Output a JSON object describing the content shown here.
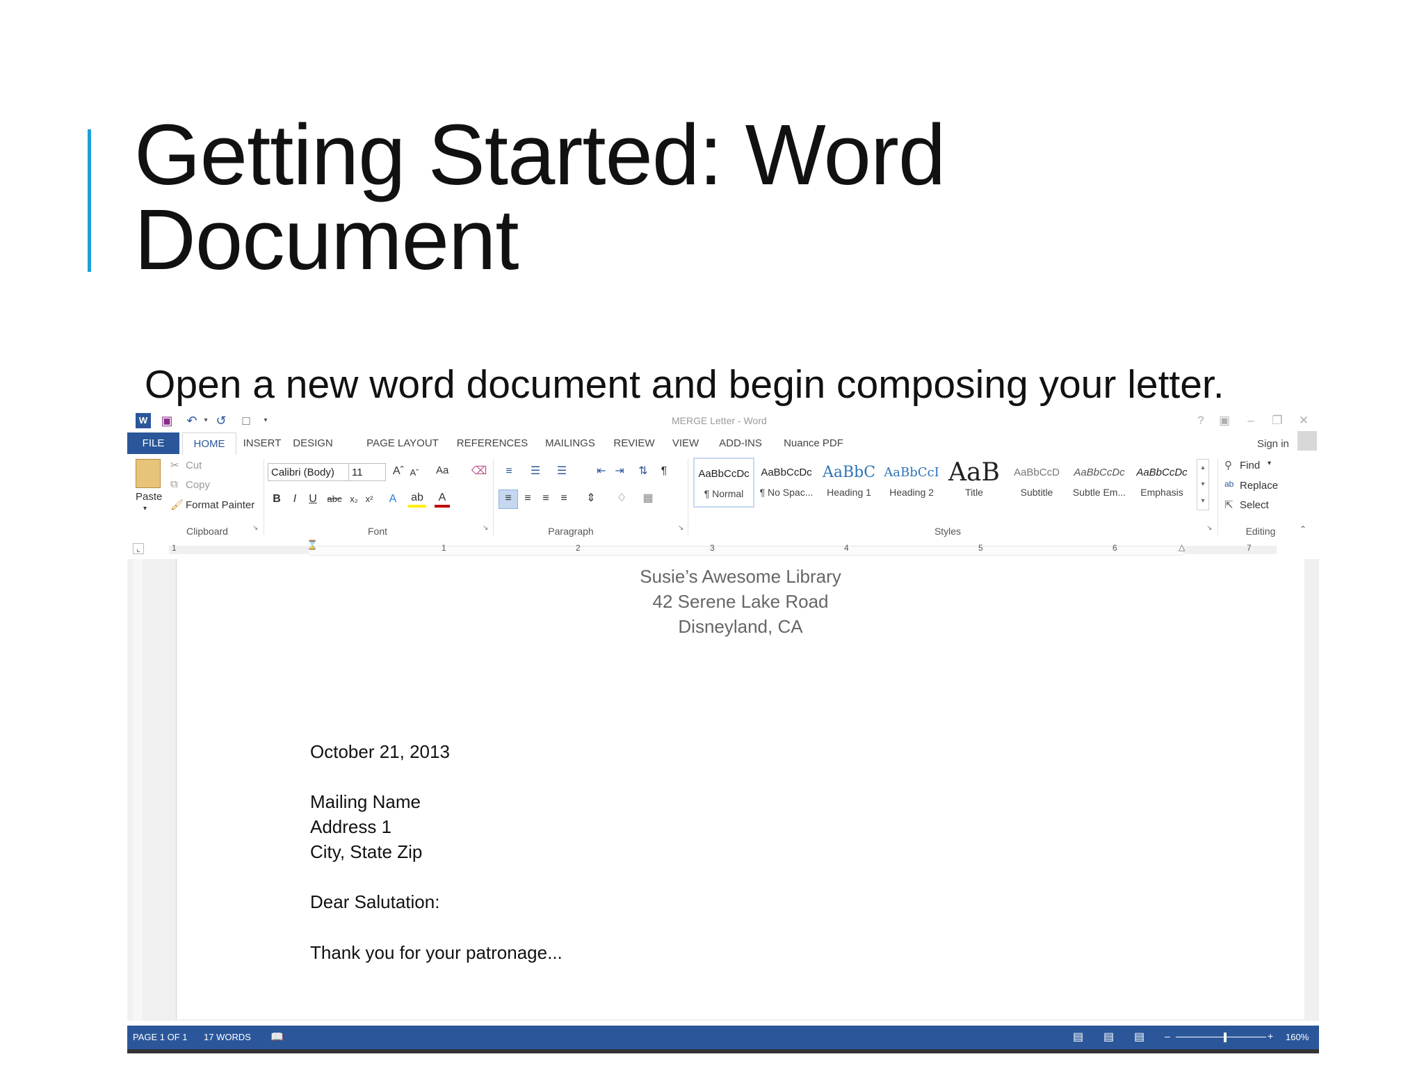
{
  "slide": {
    "title_line1": "Getting Started: Word",
    "title_line2": "Document",
    "subtitle": "Open a new word document and begin composing your letter.",
    "accent_color": "#1ba1d8"
  },
  "word": {
    "window_title": "MERGE Letter - Word",
    "sign_in": "Sign in",
    "tabs": [
      "FILE",
      "HOME",
      "INSERT",
      "DESIGN",
      "PAGE LAYOUT",
      "REFERENCES",
      "MAILINGS",
      "REVIEW",
      "VIEW",
      "ADD-INS",
      "Nuance PDF"
    ],
    "clipboard": {
      "paste": "Paste",
      "cut": "Cut",
      "copy": "Copy",
      "format_painter": "Format Painter",
      "label": "Clipboard"
    },
    "font": {
      "name": "Calibri (Body)",
      "size": "11",
      "case": "Aa",
      "label": "Font"
    },
    "paragraph": {
      "label": "Paragraph"
    },
    "styles": {
      "label": "Styles",
      "items": [
        {
          "preview": "AaBbCcDc",
          "name": "¶ Normal"
        },
        {
          "preview": "AaBbCcDc",
          "name": "¶ No Spac..."
        },
        {
          "preview": "AaBbC",
          "name": "Heading 1"
        },
        {
          "preview": "AaBbCcI",
          "name": "Heading 2"
        },
        {
          "preview": "AaB",
          "name": "Title"
        },
        {
          "preview": "AaBbCcD",
          "name": "Subtitle"
        },
        {
          "preview": "AaBbCcDc",
          "name": "Subtle Em..."
        },
        {
          "preview": "AaBbCcDc",
          "name": "Emphasis"
        }
      ]
    },
    "editing": {
      "find": "Find",
      "replace": "Replace",
      "select": "Select",
      "label": "Editing"
    },
    "ruler_numbers": [
      "1",
      "1",
      "2",
      "3",
      "4",
      "5",
      "6",
      "7"
    ],
    "document": {
      "letterhead": [
        "Susie’s Awesome Library",
        "42 Serene Lake Road",
        "Disneyland, CA"
      ],
      "date": "October 21, 2013",
      "mailing_name": "Mailing Name",
      "address": "Address 1",
      "city": "City, State Zip",
      "salutation": "Dear Salutation:",
      "body": "Thank you for your patronage..."
    },
    "status": {
      "page": "PAGE 1 OF 1",
      "words": "17 WORDS",
      "zoom": "160%"
    },
    "accent_color": "#2b579a"
  }
}
